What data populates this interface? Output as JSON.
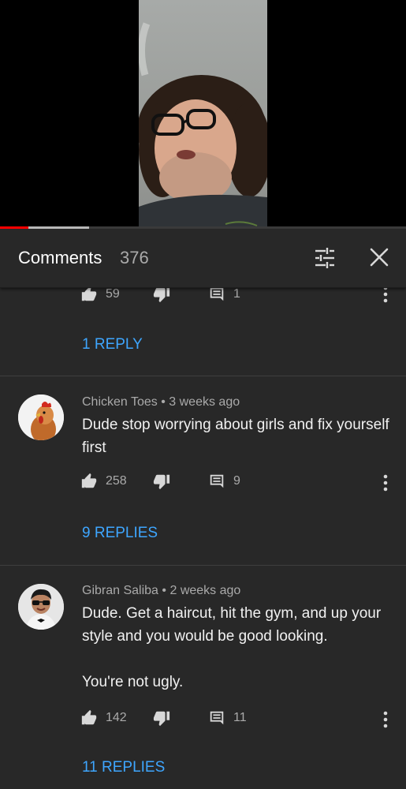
{
  "header": {
    "title": "Comments",
    "count": "376"
  },
  "player": {
    "played_fraction": 0.07,
    "buffered_fraction": 0.22
  },
  "comments": [
    {
      "likes": "59",
      "replies_count": "1",
      "replies_label": "1 REPLY"
    },
    {
      "author": "Chicken Toes",
      "time": "3 weeks ago",
      "text": "Dude stop worrying about girls and fix yourself first",
      "likes": "258",
      "replies_count": "9",
      "replies_label": "9 REPLIES"
    },
    {
      "author": "Gibran Saliba",
      "time": "2 weeks ago",
      "text_line1": "Dude. Get a haircut, hit the gym, and up your style and you would be good looking.",
      "text_line2": "You're not ugly.",
      "likes": "142",
      "replies_count": "11",
      "replies_label": "11 REPLIES"
    }
  ],
  "separator": "•",
  "colors": {
    "background": "#282828",
    "link": "#3ea6ff",
    "progress": "#ff0000",
    "secondary_text": "#aaaaaa"
  },
  "icons": [
    "sort-icon",
    "close-icon",
    "thumbs-up-icon",
    "thumbs-down-icon",
    "reply-icon",
    "more-vert-icon"
  ]
}
